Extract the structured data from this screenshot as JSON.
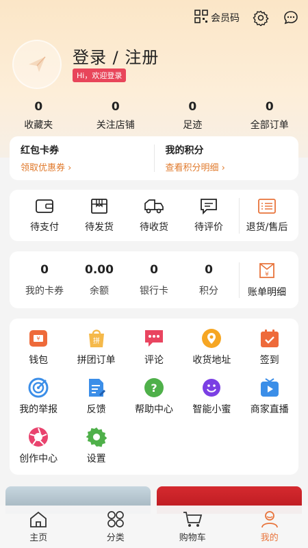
{
  "header": {
    "member_code_label": "会员码",
    "login_title": "登录 / 注册",
    "welcome": "Hi，欢迎登录"
  },
  "stats": [
    {
      "value": "0",
      "label": "收藏夹"
    },
    {
      "value": "0",
      "label": "关注店铺"
    },
    {
      "value": "0",
      "label": "足迹"
    },
    {
      "value": "0",
      "label": "全部订单"
    }
  ],
  "coupons": {
    "left_title": "红包卡券",
    "left_link": "领取优惠券",
    "right_title": "我的积分",
    "right_link": "查看积分明细"
  },
  "orders": [
    {
      "label": "待支付",
      "icon": "wallet-icon"
    },
    {
      "label": "待发货",
      "icon": "package-icon"
    },
    {
      "label": "待收货",
      "icon": "truck-icon"
    },
    {
      "label": "待评价",
      "icon": "comment-icon"
    },
    {
      "label": "退货/售后",
      "icon": "refund-icon"
    }
  ],
  "wallet": [
    {
      "value": "0",
      "label": "我的卡券"
    },
    {
      "value": "0.00",
      "label": "余额"
    },
    {
      "value": "0",
      "label": "银行卡"
    },
    {
      "value": "0",
      "label": "积分"
    }
  ],
  "bill_label": "账单明细",
  "services": [
    {
      "label": "钱包",
      "icon": "wallet-icon"
    },
    {
      "label": "拼团订单",
      "icon": "group-buy-icon"
    },
    {
      "label": "评论",
      "icon": "comment-icon"
    },
    {
      "label": "收货地址",
      "icon": "location-icon"
    },
    {
      "label": "签到",
      "icon": "checkin-icon"
    },
    {
      "label": "我的举报",
      "icon": "report-icon"
    },
    {
      "label": "反馈",
      "icon": "feedback-icon"
    },
    {
      "label": "帮助中心",
      "icon": "help-icon"
    },
    {
      "label": "智能小蜜",
      "icon": "assistant-icon"
    },
    {
      "label": "商家直播",
      "icon": "live-icon"
    },
    {
      "label": "创作中心",
      "icon": "creator-icon"
    },
    {
      "label": "设置",
      "icon": "settings-icon"
    }
  ],
  "tabs": [
    {
      "label": "主页",
      "icon": "home-icon"
    },
    {
      "label": "分类",
      "icon": "category-icon"
    },
    {
      "label": "购物车",
      "icon": "cart-icon"
    },
    {
      "label": "我的",
      "icon": "profile-icon"
    }
  ],
  "colors": {
    "accent": "#e8733a",
    "badge": "#e8455a",
    "link": "#e0792b"
  }
}
